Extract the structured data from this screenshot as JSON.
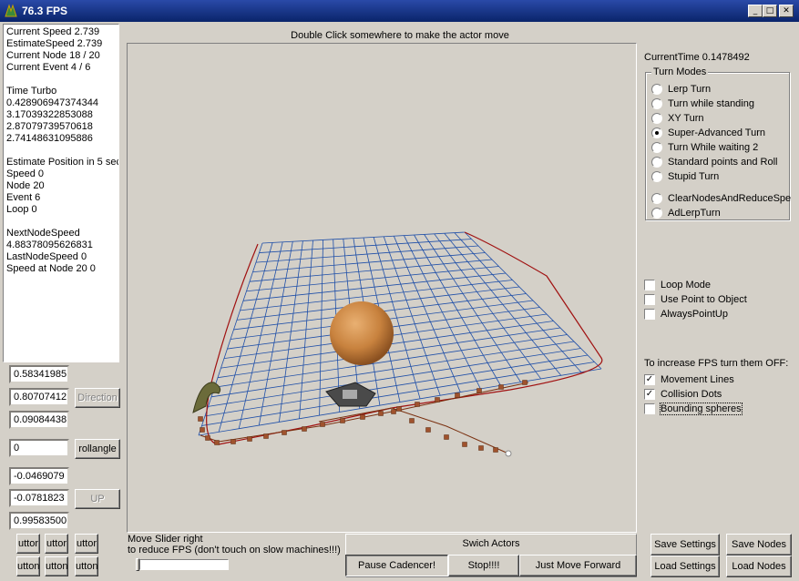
{
  "window": {
    "title": "76.3 FPS"
  },
  "info_panel": {
    "lines": [
      "Current Speed  2.739",
      "EstimateSpeed  2.739",
      "Current Node   18 / 20",
      "Current Event  4 / 6",
      "",
      "Time Turbo",
      "0.428906947374344",
      "3.17039322853088",
      "2.87079739570618",
      "2.74148631095886",
      "",
      "Estimate Position in 5 sec",
      "Speed  0",
      "Node  20",
      "Event 6",
      "Loop  0",
      "",
      "NextNodeSpeed",
      "4.88378095626831",
      "LastNodeSpeed 0",
      "Speed at Node 20 0"
    ]
  },
  "direction_fields": [
    "0.58341985",
    "0.80707412",
    "0.09084438"
  ],
  "direction_button": "Direction",
  "roll_field": "0",
  "roll_button": "rollangle",
  "up_fields": [
    "-0.0469079",
    "-0.0781823",
    "0.99583500"
  ],
  "up_button": "UP",
  "small_buttons": [
    "uttor",
    "uttor",
    "uttor",
    "utton",
    "utton",
    "utton"
  ],
  "viewport": {
    "hint": "Double Click somewhere to make the actor move"
  },
  "current_time": "CurrentTime  0.1478492",
  "turn_modes": {
    "label": "Turn Modes",
    "options": [
      "Lerp Turn",
      "Turn while standing",
      "XY Turn",
      "Super-Advanced Turn",
      "Turn While waiting 2",
      "Standard points and Roll",
      "Stupid Turn",
      "ClearNodesAndReduceSpe",
      "AdLerpTurn"
    ],
    "selected": "Super-Advanced Turn"
  },
  "options": [
    {
      "label": "Loop Mode",
      "checked": false
    },
    {
      "label": "Use Point to Object",
      "checked": false
    },
    {
      "label": "AlwaysPointUp",
      "checked": false
    }
  ],
  "fps_hint": "To increase FPS turn them OFF:",
  "fps_options": [
    {
      "label": "Movement Lines",
      "checked": true
    },
    {
      "label": "Collision Dots",
      "checked": true
    },
    {
      "label": "Bounding spheres",
      "checked": false
    }
  ],
  "slider": {
    "line1": "Move Slider right",
    "line2": "to reduce FPS (don't touch on slow machines!!!)",
    "level": 0
  },
  "actors": {
    "label": "Swich Actors",
    "pause": "Pause Cadencer!",
    "stop": "Stop!!!!",
    "forward": "Just Move Forward"
  },
  "settings": {
    "save": "Save Settings",
    "load": "Load Settings"
  },
  "nodes": {
    "save": "Save Nodes",
    "load": "Load Nodes"
  },
  "colors": {
    "grid_line": "#1f4fa8",
    "path_line": "#a01010",
    "node_dot": "#a0522d",
    "sphere": "#c8823e",
    "titlebar": "#0a246a"
  }
}
